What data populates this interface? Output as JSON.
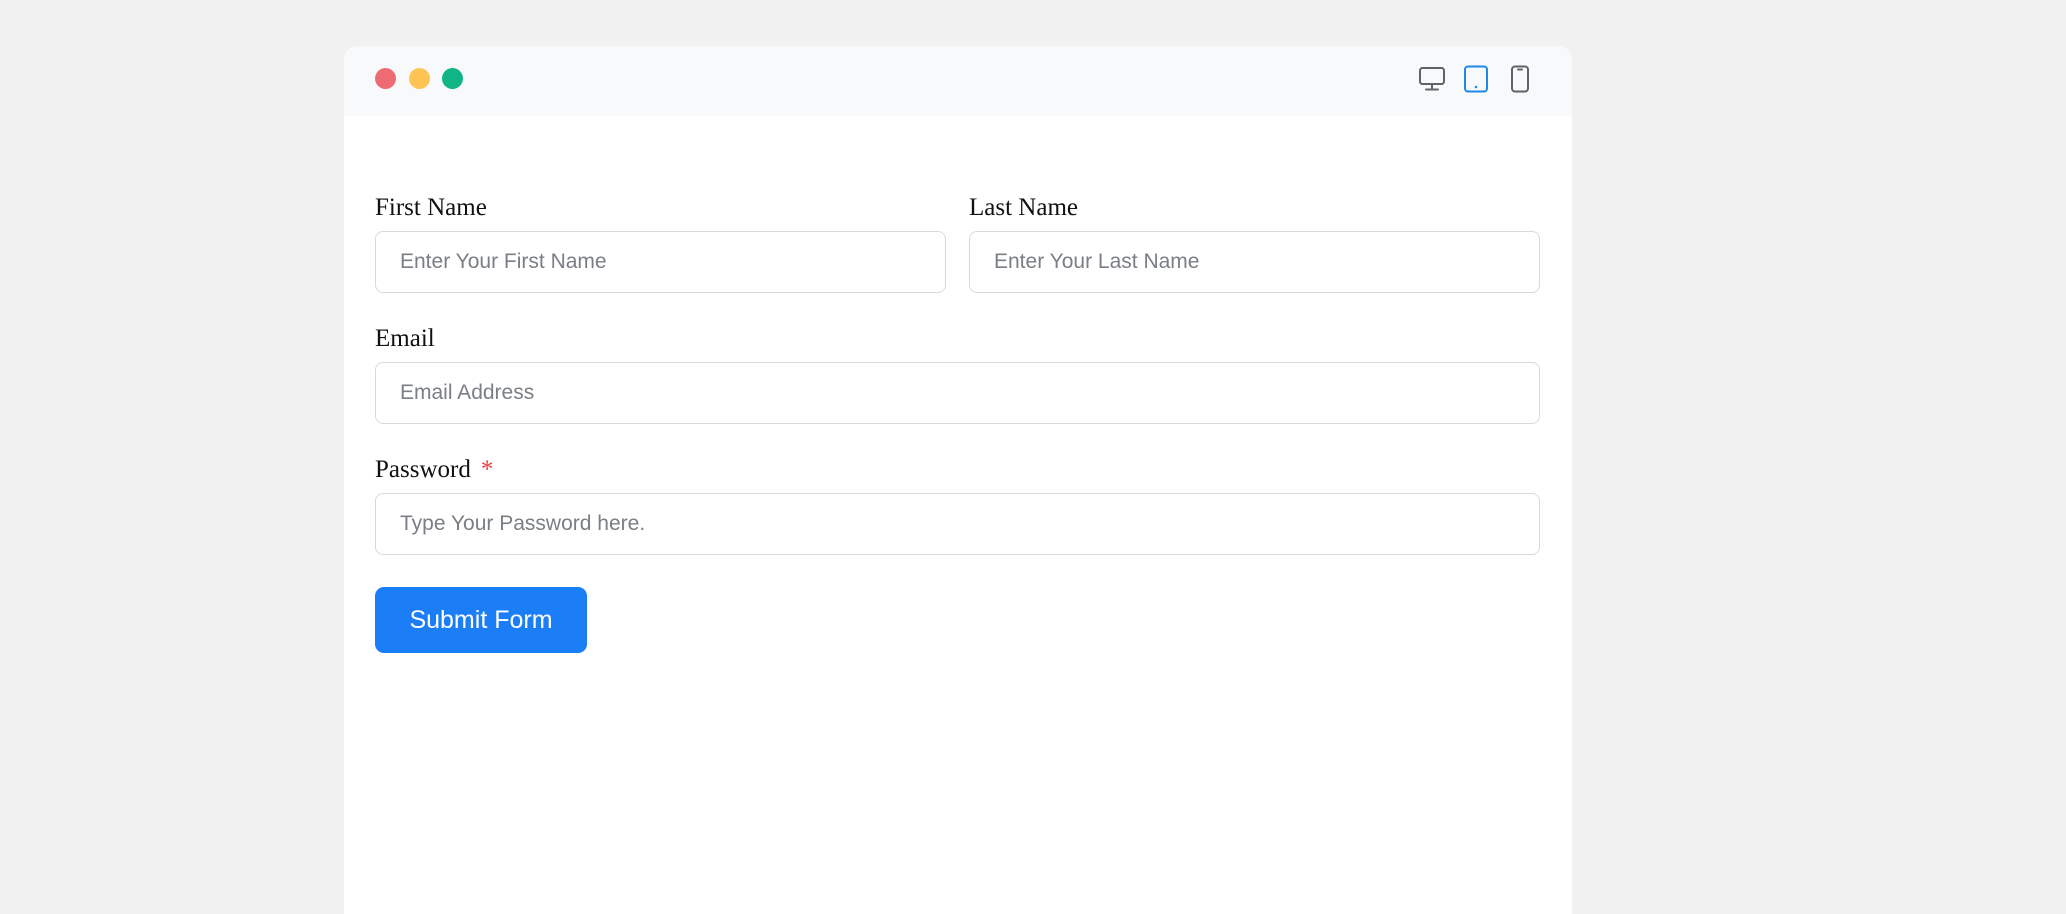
{
  "window_controls": {
    "close_color": "#ef6b73",
    "minimize_color": "#fdc454",
    "maximize_color": "#10b485"
  },
  "device_toggle": {
    "items": [
      {
        "icon": "desktop-icon",
        "active": false
      },
      {
        "icon": "tablet-icon",
        "active": true
      },
      {
        "icon": "mobile-icon",
        "active": false
      }
    ],
    "active_color": "#1e88e5",
    "inactive_color": "#5f6368"
  },
  "form": {
    "first_name": {
      "label": "First Name",
      "placeholder": "Enter Your First Name",
      "value": ""
    },
    "last_name": {
      "label": "Last Name",
      "placeholder": "Enter Your Last Name",
      "value": ""
    },
    "email": {
      "label": "Email",
      "placeholder": "Email Address",
      "value": ""
    },
    "password": {
      "label": "Password",
      "required_marker": "*",
      "placeholder": "Type Your Password here.",
      "value": ""
    },
    "submit_label": "Submit Form"
  },
  "colors": {
    "accent": "#1b7ef7",
    "required": "#e53e3e",
    "page_background": "#f1f1f1",
    "titlebar_background": "#f8f9fa"
  }
}
